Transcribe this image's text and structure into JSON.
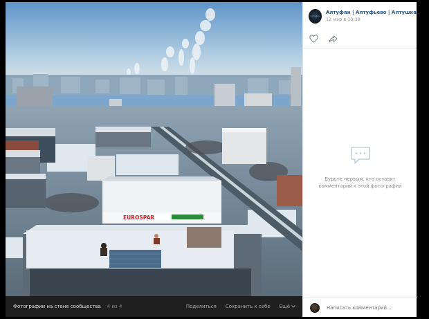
{
  "post": {
    "author": "Алтуфан | Алтуфьево | Алтушка",
    "date": "12 мар в 10:38",
    "avatar_text": "Алтуфан"
  },
  "photo": {
    "store_sign": "EUROSPAR"
  },
  "bottom_bar": {
    "album": "Фотографии на стене сообщества",
    "counter": "4 из 4",
    "share": "Поделиться",
    "save": "Сохранить к себе",
    "more": "Ещё"
  },
  "comments": {
    "empty_message": "Будьте первым, кто оставит комментарий к этой фотографии",
    "placeholder": "Написать комментарий..."
  },
  "icons": {
    "like": "heart-icon",
    "share": "share-arrow-icon",
    "empty": "comment-bubble-icon",
    "more_chevron": "chevron-down-icon"
  },
  "colors": {
    "link": "#2a5885",
    "muted": "#939393",
    "sidebar_bg": "#ffffff",
    "viewer_bg": "#1a1a1a"
  }
}
